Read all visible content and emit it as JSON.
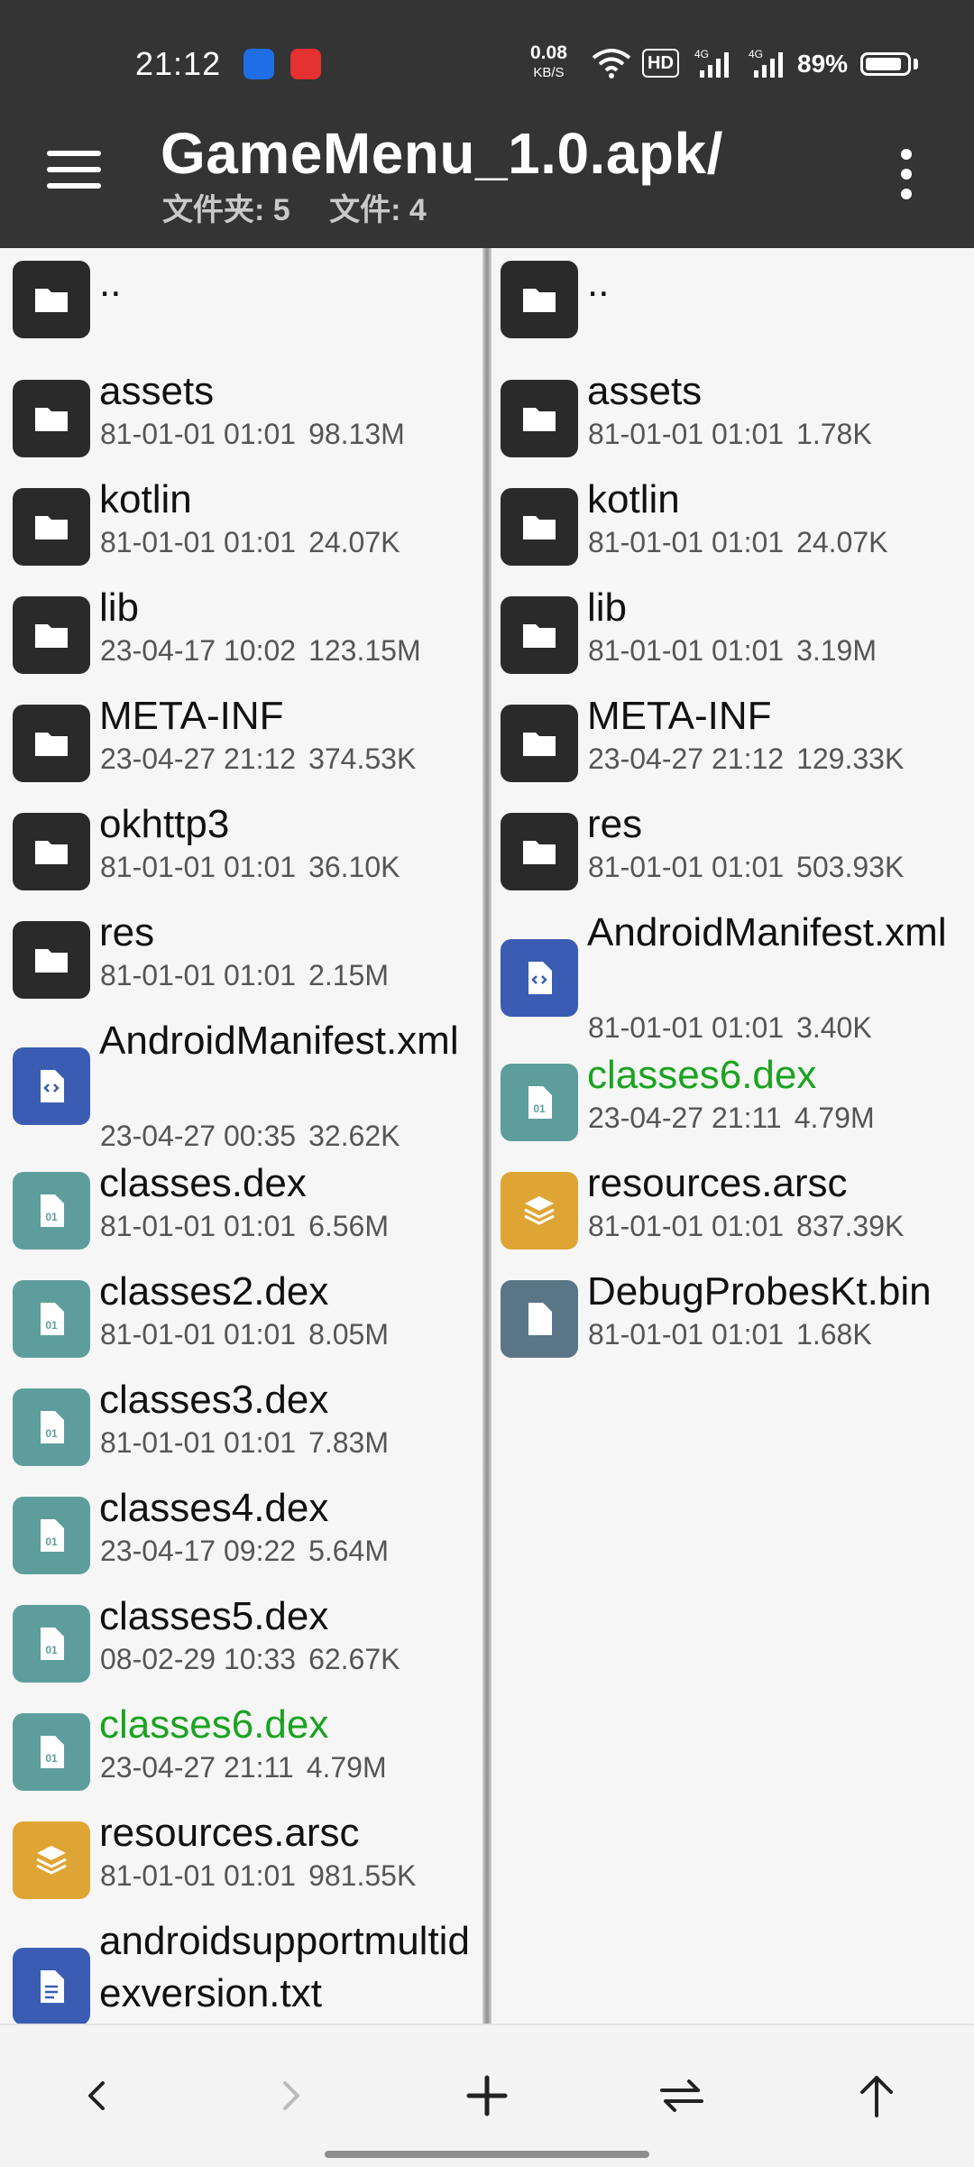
{
  "status_bar": {
    "time": "21:12",
    "net_speed": "0.08",
    "net_speed_unit": "KB/S",
    "hd_badge": "HD",
    "battery_percent": "89%",
    "battery_level": 0.89
  },
  "app_bar": {
    "title": "GameMenu_1.0.apk/",
    "folders_label": "文件夹: 5",
    "files_label": "文件: 4"
  },
  "icons": {
    "folder": "folder-icon",
    "xml": "code-file-icon",
    "dex": "binary-file-icon",
    "arsc": "layers-icon",
    "bin": "file-icon",
    "txt": "text-file-icon"
  },
  "colors": {
    "app_bar": "#343434",
    "highlight_text": "#1aa31f",
    "folder_tile": "#2a2a2a",
    "xml_tile": "#3a5db3",
    "dex_tile": "#5d9e9c",
    "arsc_tile": "#dfa534",
    "bin_tile": "#5a7686"
  },
  "left_pane": {
    "items": [
      {
        "name": "..",
        "type": "folder"
      },
      {
        "name": "assets",
        "date": "81-01-01 01:01",
        "size": "98.13M",
        "type": "folder"
      },
      {
        "name": "kotlin",
        "date": "81-01-01 01:01",
        "size": "24.07K",
        "type": "folder"
      },
      {
        "name": "lib",
        "date": "23-04-17 10:02",
        "size": "123.15M",
        "type": "folder"
      },
      {
        "name": "META-INF",
        "date": "23-04-27 21:12",
        "size": "374.53K",
        "type": "folder"
      },
      {
        "name": "okhttp3",
        "date": "81-01-01 01:01",
        "size": "36.10K",
        "type": "folder"
      },
      {
        "name": "res",
        "date": "81-01-01 01:01",
        "size": "2.15M",
        "type": "folder"
      },
      {
        "name": "AndroidManifest.xml",
        "date": "23-04-27 00:35",
        "size": "32.62K",
        "type": "xml"
      },
      {
        "name": "classes.dex",
        "date": "81-01-01 01:01",
        "size": "6.56M",
        "type": "dex"
      },
      {
        "name": "classes2.dex",
        "date": "81-01-01 01:01",
        "size": "8.05M",
        "type": "dex"
      },
      {
        "name": "classes3.dex",
        "date": "81-01-01 01:01",
        "size": "7.83M",
        "type": "dex"
      },
      {
        "name": "classes4.dex",
        "date": "23-04-17 09:22",
        "size": "5.64M",
        "type": "dex"
      },
      {
        "name": "classes5.dex",
        "date": "08-02-29 10:33",
        "size": "62.67K",
        "type": "dex"
      },
      {
        "name": "classes6.dex",
        "date": "23-04-27 21:11",
        "size": "4.79M",
        "type": "dex",
        "highlight": true
      },
      {
        "name": "resources.arsc",
        "date": "81-01-01 01:01",
        "size": "981.55K",
        "type": "arsc"
      },
      {
        "name": "androidsupportmultidexversion.txt",
        "type": "txt"
      }
    ]
  },
  "right_pane": {
    "items": [
      {
        "name": "..",
        "type": "folder"
      },
      {
        "name": "assets",
        "date": "81-01-01 01:01",
        "size": "1.78K",
        "type": "folder"
      },
      {
        "name": "kotlin",
        "date": "81-01-01 01:01",
        "size": "24.07K",
        "type": "folder"
      },
      {
        "name": "lib",
        "date": "81-01-01 01:01",
        "size": "3.19M",
        "type": "folder"
      },
      {
        "name": "META-INF",
        "date": "23-04-27 21:12",
        "size": "129.33K",
        "type": "folder"
      },
      {
        "name": "res",
        "date": "81-01-01 01:01",
        "size": "503.93K",
        "type": "folder"
      },
      {
        "name": "AndroidManifest.xml",
        "date": "81-01-01 01:01",
        "size": "3.40K",
        "type": "xml"
      },
      {
        "name": "classes6.dex",
        "date": "23-04-27 21:11",
        "size": "4.79M",
        "type": "dex",
        "highlight": true
      },
      {
        "name": "resources.arsc",
        "date": "81-01-01 01:01",
        "size": "837.39K",
        "type": "arsc"
      },
      {
        "name": "DebugProbesKt.bin",
        "date": "81-01-01 01:01",
        "size": "1.68K",
        "type": "bin"
      }
    ]
  },
  "toolbar": {
    "buttons": [
      "back-icon",
      "forward-icon",
      "add-icon",
      "swap-icon",
      "up-icon"
    ]
  }
}
